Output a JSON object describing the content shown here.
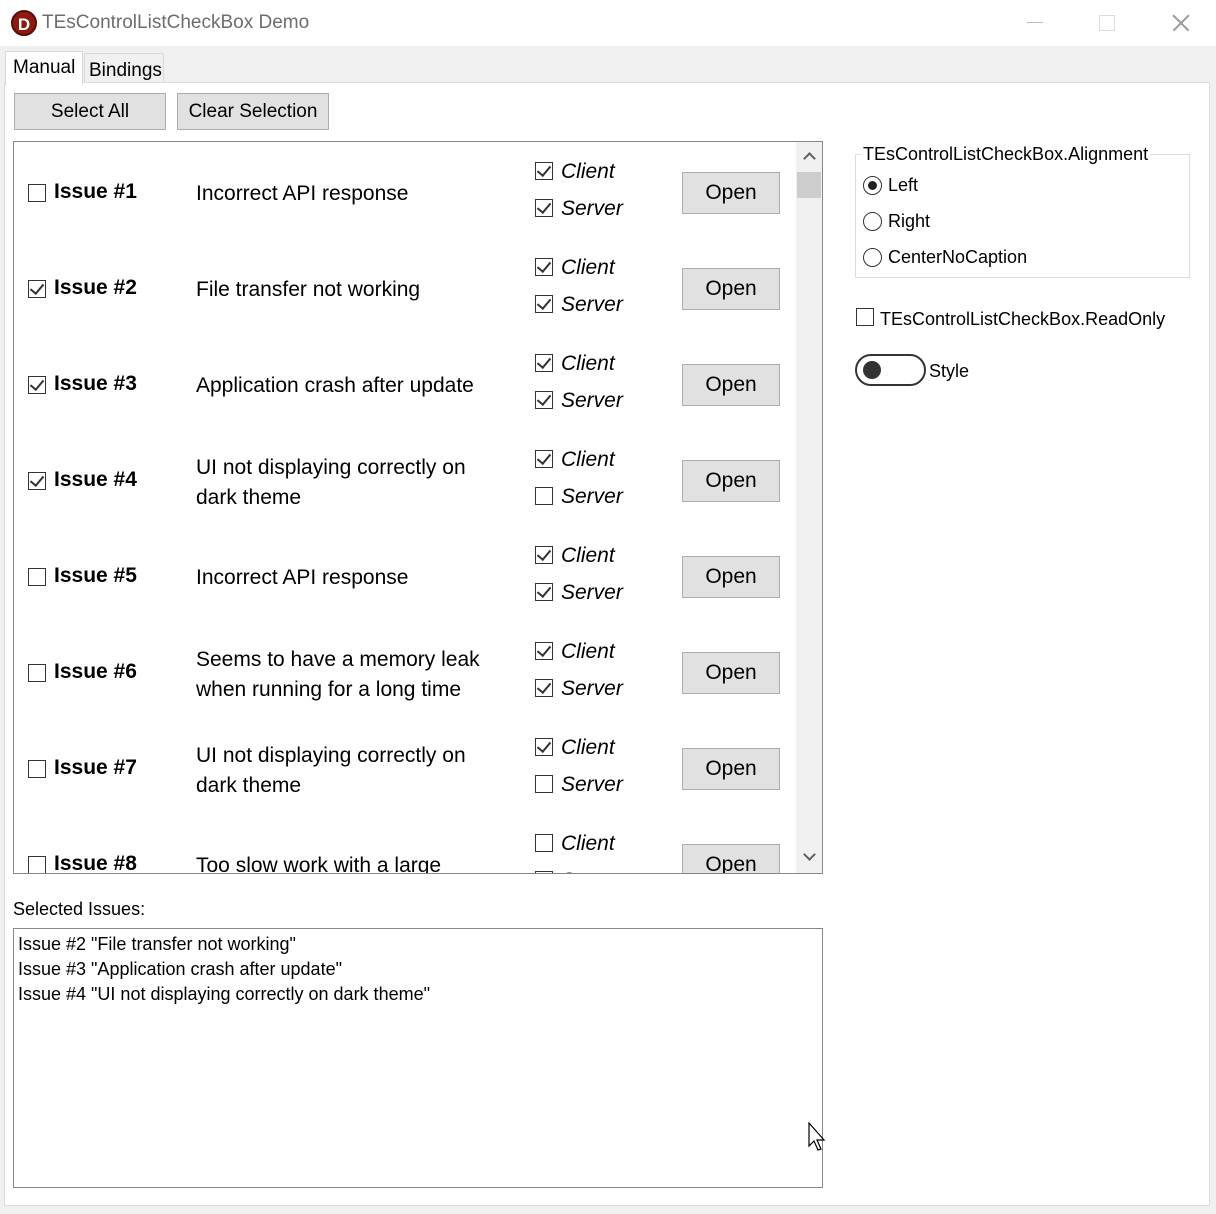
{
  "window": {
    "title": "TEsControlListCheckBox Demo",
    "icon_letter": "D"
  },
  "tabs": [
    {
      "label": "Manual",
      "active": true
    },
    {
      "label": "Bindings",
      "active": false
    }
  ],
  "toolbar": {
    "select_all": "Select All",
    "clear_selection": "Clear Selection"
  },
  "issues": [
    {
      "title": "Issue #1",
      "desc": "Incorrect API response",
      "checked": false,
      "client": true,
      "server": true,
      "open": "Open"
    },
    {
      "title": "Issue #2",
      "desc": "File transfer not working",
      "checked": true,
      "client": true,
      "server": true,
      "open": "Open"
    },
    {
      "title": "Issue #3",
      "desc": "Application crash after update",
      "checked": true,
      "client": true,
      "server": true,
      "open": "Open"
    },
    {
      "title": "Issue #4",
      "desc": "UI not displaying correctly on dark theme",
      "checked": true,
      "client": true,
      "server": false,
      "open": "Open"
    },
    {
      "title": "Issue #5",
      "desc": "Incorrect API response",
      "checked": false,
      "client": true,
      "server": true,
      "open": "Open"
    },
    {
      "title": "Issue #6",
      "desc": "Seems to have a memory leak when running for a long time",
      "checked": false,
      "client": true,
      "server": true,
      "open": "Open"
    },
    {
      "title": "Issue #7",
      "desc": "UI not displaying correctly on dark theme",
      "checked": false,
      "client": true,
      "server": false,
      "open": "Open"
    },
    {
      "title": "Issue #8",
      "desc": "Too slow work with a large",
      "checked": false,
      "client": false,
      "server": false,
      "open": "Open"
    }
  ],
  "labels": {
    "client": "Client",
    "server": "Server"
  },
  "selected": {
    "label": "Selected Issues:",
    "lines": [
      "Issue #2 \"File transfer not working\"",
      "Issue #3 \"Application crash after update\"",
      "Issue #4 \"UI not displaying correctly on dark theme\""
    ]
  },
  "alignment": {
    "title": "TEsControlListCheckBox.Alignment",
    "options": [
      {
        "label": "Left",
        "checked": true
      },
      {
        "label": "Right",
        "checked": false
      },
      {
        "label": "CenterNoCaption",
        "checked": false
      }
    ]
  },
  "readonly": {
    "label": "TEsControlListCheckBox.ReadOnly",
    "checked": false
  },
  "style_toggle": {
    "label": "Style",
    "on": false
  }
}
